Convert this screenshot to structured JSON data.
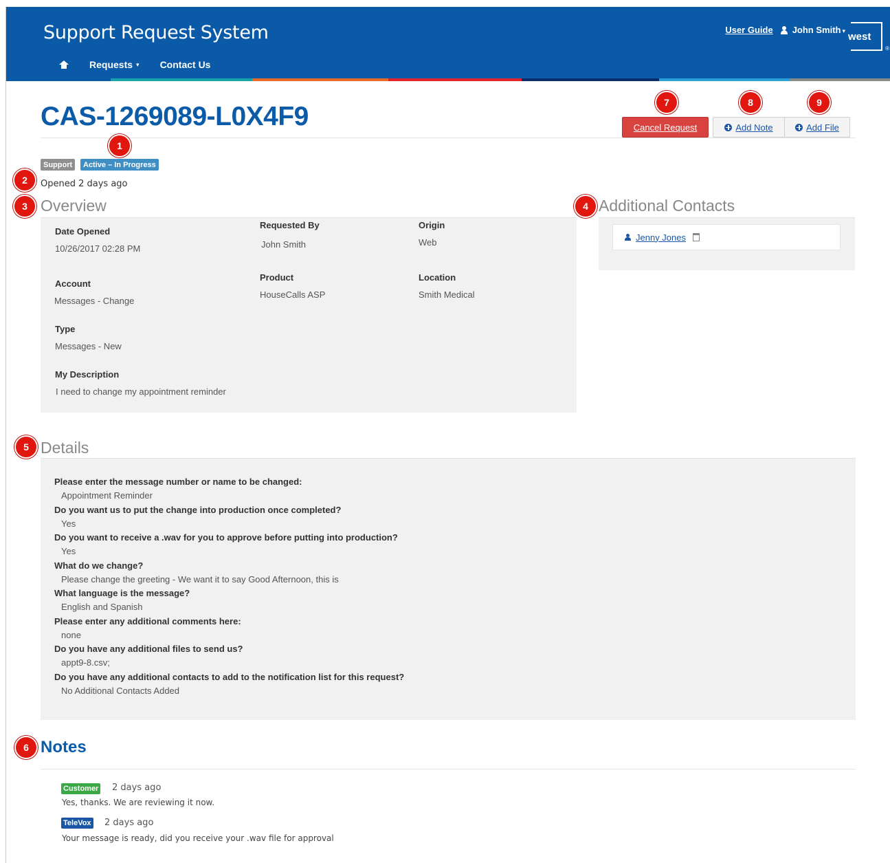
{
  "header": {
    "app_title": "Support Request System",
    "user_guide": "User Guide",
    "user_name": "John Smith",
    "caret": "▾",
    "logo_text": "west",
    "logo_mark": "®",
    "nav": {
      "requests": "Requests",
      "contact_us": "Contact Us",
      "caret": "▾"
    },
    "stripe_colors": [
      "#0a5aa8",
      "#17a3a7",
      "#e86a2a",
      "#e0232c",
      "#e0232c",
      "#0a2c6b",
      "#2a9fd8",
      "#8a8a8a"
    ]
  },
  "case": {
    "id": "CAS-1269089-L0X4F9",
    "labels": {
      "support": "Support",
      "status": "Active – In Progress"
    },
    "opened": "Opened 2 days ago"
  },
  "actions": {
    "cancel": "Cancel Request",
    "add_note": "Add Note",
    "add_file": "Add File"
  },
  "callouts": [
    "1",
    "2",
    "3",
    "4",
    "5",
    "6",
    "7",
    "8",
    "9"
  ],
  "overview": {
    "title": "Overview",
    "date_opened_label": "Date Opened",
    "date_opened_value": "10/26/2017 02:28 PM",
    "requested_by_label": "Requested By",
    "requested_by_value": "John Smith",
    "origin_label": "Origin",
    "origin_value": "Web",
    "account_label": "Account",
    "account_value": "Messages - Change",
    "product_label": "Product",
    "product_value": "HouseCalls ASP",
    "location_label": "Location",
    "location_value": "Smith Medical",
    "type_label": "Type",
    "type_value": "Messages - New",
    "description_label": "My Description",
    "description_value": "I need to change my appointment reminder"
  },
  "additional_contacts": {
    "title": "Additional Contacts",
    "contact_name": "Jenny Jones"
  },
  "details": {
    "title": "Details",
    "items": [
      {
        "q": "Please enter the message number or name to be changed:",
        "a": "Appointment Reminder"
      },
      {
        "q": "Do you want us to put the change into production once completed?",
        "a": "Yes"
      },
      {
        "q": "Do you want to receive a .wav for you to approve before putting into production?",
        "a": "Yes"
      },
      {
        "q": "What do we change?",
        "a": "Please change the greeting - We want it to say Good Afternoon, this is"
      },
      {
        "q": "What language is the message?",
        "a": "English and Spanish"
      },
      {
        "q": "Please enter any additional comments here:",
        "a": "none"
      },
      {
        "q": "Do you have any additional files to send us?",
        "a": "appt9-8.csv;"
      },
      {
        "q": "Do you have any additional contacts to add to the notification list for this request?",
        "a": "No Additional Contacts Added"
      }
    ]
  },
  "notes": {
    "title": "Notes",
    "items": [
      {
        "tag": "Customer",
        "time": "2 days ago",
        "text": "Yes, thanks. We are reviewing it now."
      },
      {
        "tag": "TeleVox",
        "time": "2 days ago",
        "text": "Your message is ready, did you receive your .wav file for approval"
      }
    ]
  },
  "colors": {
    "header_bg": "#0a5aa8",
    "title_blue": "#0b5ba8",
    "danger": "#d9433f",
    "callout_red": "#e0160f",
    "label_grey": "#8f8f8f",
    "label_info": "#3f8fc4",
    "tag_customer": "#3aa845",
    "tag_televox": "#1a56a6"
  }
}
